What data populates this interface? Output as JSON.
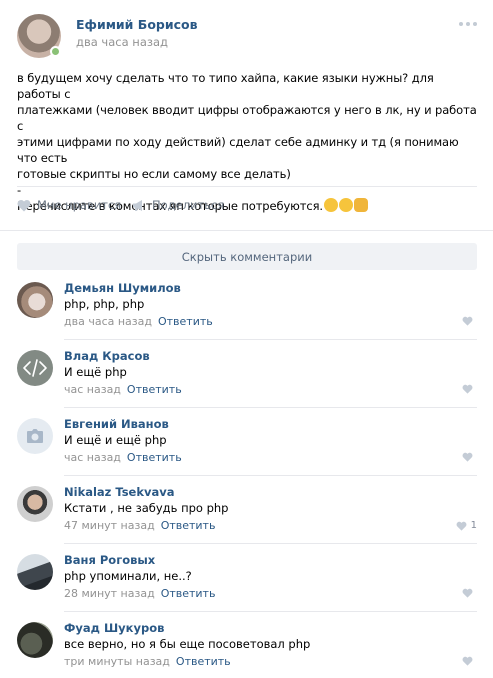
{
  "post": {
    "author": "Ефимий Борисов",
    "time": "два часа назад",
    "text_lines": [
      "в будущем хочу сделать что то типо хайпа, какие языки нужны? для работы с",
      "платежками (человек вводит цифры отображаются у него в лк, ну и работа с",
      "этими цифрами по ходу действий) сделат себе админку и тд (я понимаю что есть",
      "готовые скрипты но если самому все делать)",
      "-",
      "Перечислите в коментах яп которые потребуются."
    ],
    "emoji_icons": [
      "winking-face-emoji-icon",
      "smiling-face-emoji-icon",
      "grinning-face-emoji-icon"
    ]
  },
  "actions": {
    "like_label": "Мне нравится",
    "share_label": "Поделиться"
  },
  "comments_toggle": "Скрыть комментарии",
  "comments": [
    {
      "name": "Демьян Шумилов",
      "text": "php, php, php",
      "time": "два часа назад",
      "reply": "Ответить",
      "likes": ""
    },
    {
      "name": "Влад Красов",
      "text": "И ещё php",
      "time": "час назад",
      "reply": "Ответить",
      "likes": ""
    },
    {
      "name": "Евгений Иванов",
      "text": "И ещё и ещё php",
      "time": "час назад",
      "reply": "Ответить",
      "likes": ""
    },
    {
      "name": "Nikalaz Tsekvava",
      "text": "Кстати , не забудь про php",
      "time": "47 минут назад",
      "reply": "Ответить",
      "likes": "1"
    },
    {
      "name": "Ваня Роговых",
      "text": "php упоминали, не..?",
      "time": "28 минут назад",
      "reply": "Ответить",
      "likes": ""
    },
    {
      "name": "Фуад Шукуров",
      "text": "все верно, но я бы еще посоветовал php",
      "time": "три минуты назад",
      "reply": "Ответить",
      "likes": ""
    }
  ],
  "colors": {
    "link": "#2a5885",
    "muted": "#939393",
    "online": "#8ac176",
    "toggle_bg": "#f0f2f5"
  }
}
